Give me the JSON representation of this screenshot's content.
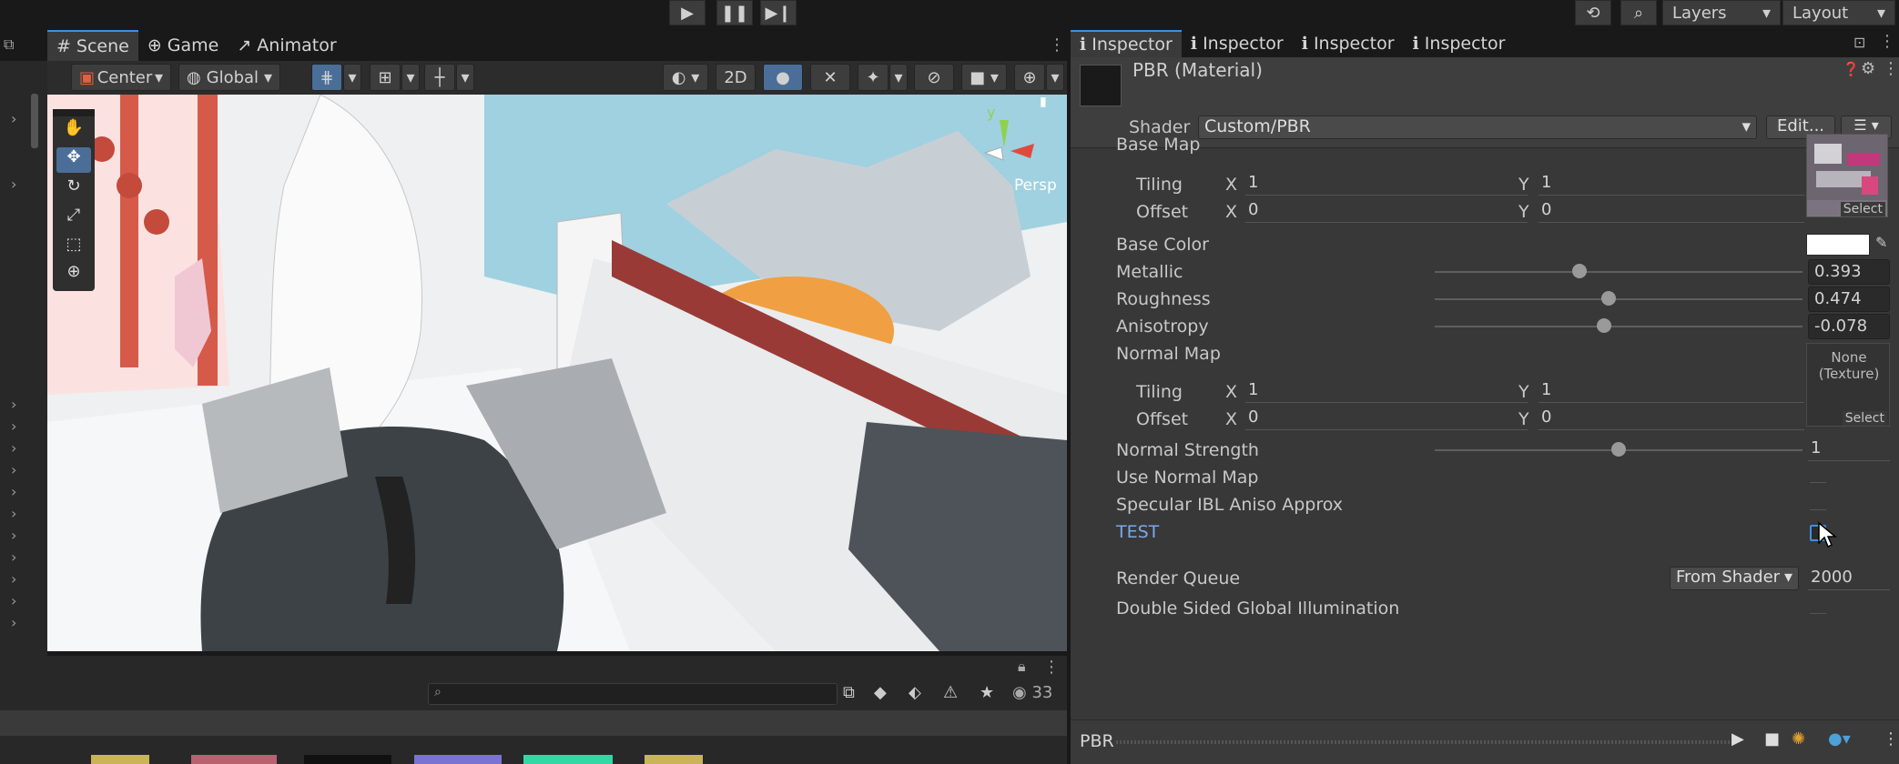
{
  "toolbar": {
    "play_icon": "play-icon",
    "pause_icon": "pause-icon",
    "step_icon": "step-icon",
    "layers_label": "Layers",
    "layout_label": "Layout"
  },
  "scene_tabs": [
    {
      "label": "Scene",
      "icon": "grid-icon"
    },
    {
      "label": "Game",
      "icon": "gamepad-icon"
    },
    {
      "label": "Animator",
      "icon": "animator-icon"
    }
  ],
  "scene_toolbar": {
    "pivot_label": "Center",
    "space_label": "Global",
    "mode_2d_label": "2D"
  },
  "gizmo": {
    "axis_label": "y",
    "projection_label": "Persp"
  },
  "bottom_panel": {
    "visibility_count": "33"
  },
  "inspector": {
    "tabs": [
      "Inspector",
      "Inspector",
      "Inspector",
      "Inspector"
    ],
    "material_title": "PBR (Material)",
    "shader_label": "Shader",
    "shader_value": "Custom/PBR",
    "edit_button": "Edit...",
    "base_map": {
      "label": "Base Map",
      "tiling_label": "Tiling",
      "offset_label": "Offset",
      "tiling_x": "1",
      "tiling_y": "1",
      "offset_x": "0",
      "offset_y": "0",
      "select_label": "Select"
    },
    "axis_x": "X",
    "axis_y": "Y",
    "base_color_label": "Base Color",
    "metallic": {
      "label": "Metallic",
      "value": "0.393",
      "fraction": 0.393
    },
    "roughness": {
      "label": "Roughness",
      "value": "0.474",
      "fraction": 0.474
    },
    "anisotropy": {
      "label": "Anisotropy",
      "value": "-0.078",
      "fraction": 0.461
    },
    "normal_map": {
      "label": "Normal Map",
      "none_texture_label": "None",
      "texture_label": "(Texture)",
      "tiling_label": "Tiling",
      "offset_label": "Offset",
      "tiling_x": "1",
      "tiling_y": "1",
      "offset_x": "0",
      "offset_y": "0",
      "select_label": "Select"
    },
    "normal_strength": {
      "label": "Normal Strength",
      "value": "1",
      "fraction": 0.5
    },
    "use_normal_map_label": "Use Normal Map",
    "specular_ibl_label": "Specular IBL Aniso Approx",
    "test_label": "TEST",
    "render_queue": {
      "label": "Render Queue",
      "mode": "From Shader",
      "value": "2000"
    },
    "double_sided_gi_label": "Double Sided Global Illumination",
    "preview_label": "PBR"
  },
  "colors": {
    "accent": "#3e8fe8",
    "test_label": "#7aa9e8",
    "panel": "#383838",
    "viewport_sky": "#9fd1e0"
  }
}
